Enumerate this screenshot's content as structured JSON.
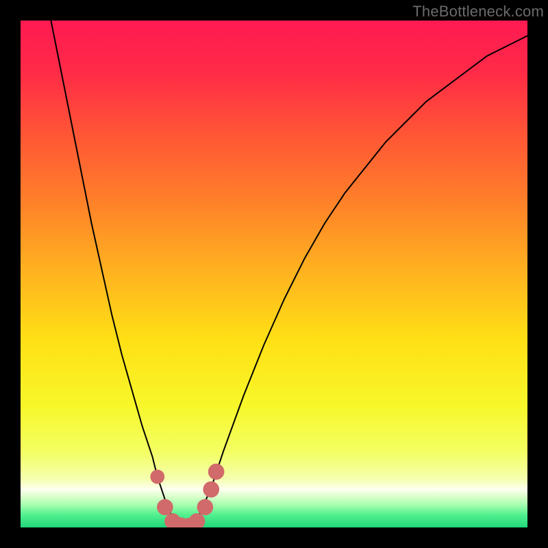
{
  "watermark": "TheBottleneck.com",
  "gradient": {
    "stops": [
      {
        "offset": 0.0,
        "color": "#ff1a52"
      },
      {
        "offset": 0.1,
        "color": "#ff2a47"
      },
      {
        "offset": 0.22,
        "color": "#ff5436"
      },
      {
        "offset": 0.35,
        "color": "#ff7e2a"
      },
      {
        "offset": 0.5,
        "color": "#ffb41f"
      },
      {
        "offset": 0.63,
        "color": "#ffe015"
      },
      {
        "offset": 0.76,
        "color": "#f7f72a"
      },
      {
        "offset": 0.85,
        "color": "#f3ff62"
      },
      {
        "offset": 0.905,
        "color": "#f5ffb0"
      },
      {
        "offset": 0.925,
        "color": "#fdfff0"
      },
      {
        "offset": 0.94,
        "color": "#d8ffc8"
      },
      {
        "offset": 0.955,
        "color": "#a8ffb0"
      },
      {
        "offset": 0.975,
        "color": "#52f08e"
      },
      {
        "offset": 1.0,
        "color": "#1fd87a"
      }
    ]
  },
  "chart_data": {
    "type": "line",
    "title": "",
    "xlabel": "",
    "ylabel": "",
    "xlim": [
      0,
      100
    ],
    "ylim": [
      0,
      100
    ],
    "grid": false,
    "legend": false,
    "series": [
      {
        "name": "bottleneck-curve",
        "x": [
          6,
          8,
          10,
          12,
          14,
          16,
          18,
          20,
          22,
          24,
          26,
          27,
          28,
          29,
          30,
          31,
          32,
          33,
          34,
          35,
          36,
          38,
          40,
          44,
          48,
          52,
          56,
          60,
          64,
          68,
          72,
          76,
          80,
          84,
          88,
          92,
          96,
          100
        ],
        "y": [
          100,
          90,
          80,
          70,
          60,
          51,
          42,
          34,
          27,
          20,
          14,
          10,
          7,
          4,
          2,
          1,
          0,
          0,
          1,
          2,
          4,
          9,
          15,
          26,
          36,
          45,
          53,
          60,
          66,
          71,
          76,
          80,
          84,
          87,
          90,
          93,
          95,
          97
        ]
      }
    ],
    "markers": [
      {
        "name": "marker-left-dot",
        "x": 27.0,
        "y": 10.0,
        "r": 1.4
      },
      {
        "name": "marker-left-bottom",
        "x": 28.5,
        "y": 4.0,
        "r": 1.6
      },
      {
        "name": "marker-valley-1",
        "x": 30.0,
        "y": 1.2,
        "r": 1.6
      },
      {
        "name": "marker-valley-2",
        "x": 31.6,
        "y": 0.4,
        "r": 1.6
      },
      {
        "name": "marker-valley-3",
        "x": 33.2,
        "y": 0.3,
        "r": 1.6
      },
      {
        "name": "marker-valley-4",
        "x": 34.8,
        "y": 1.2,
        "r": 1.6
      },
      {
        "name": "marker-right-1",
        "x": 36.4,
        "y": 4.0,
        "r": 1.6
      },
      {
        "name": "marker-right-2",
        "x": 37.6,
        "y": 7.5,
        "r": 1.6
      },
      {
        "name": "marker-right-3",
        "x": 38.6,
        "y": 11.0,
        "r": 1.6
      }
    ],
    "marker_color": "#d16a6a",
    "curve_color": "#000000"
  }
}
